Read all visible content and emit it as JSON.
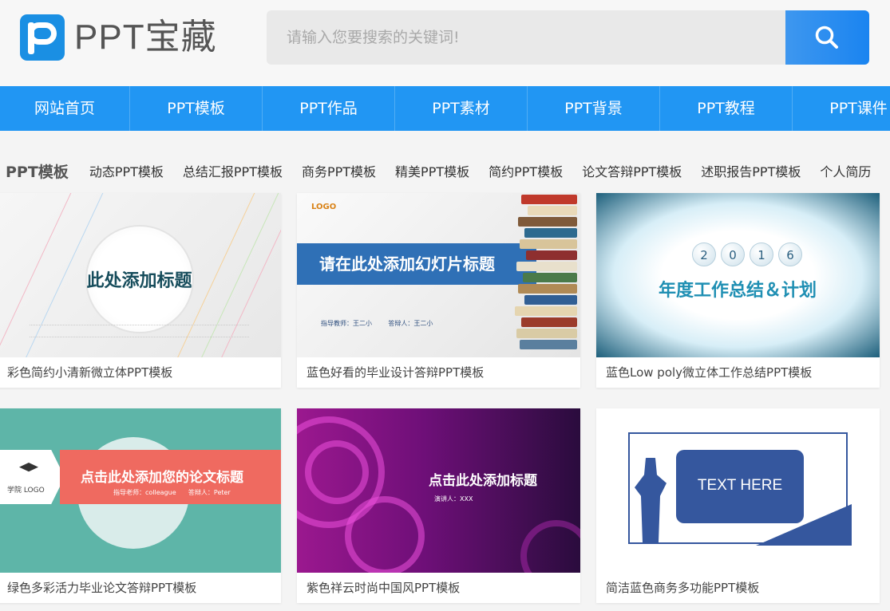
{
  "brand": {
    "logo_letter": "p",
    "name": "PPT宝藏"
  },
  "search": {
    "placeholder": "请输入您要搜索的关键词!",
    "icon": "search-icon"
  },
  "nav": {
    "items": [
      "网站首页",
      "PPT模板",
      "PPT作品",
      "PPT素材",
      "PPT背景",
      "PPT教程",
      "PPT课件"
    ]
  },
  "category": {
    "title": "PPT模板",
    "links": [
      "动态PPT模板",
      "总结汇报PPT模板",
      "商务PPT模板",
      "精美PPT模板",
      "简约PPT模板",
      "论文答辩PPT模板",
      "述职报告PPT模板",
      "个人简历"
    ]
  },
  "cards": [
    {
      "caption": "彩色简约小清新微立体PPT模板",
      "thumb": {
        "title": "此处添加标题"
      }
    },
    {
      "caption": "蓝色好看的毕业设计答辩PPT模板",
      "thumb": {
        "logo": "LOGO",
        "title": "请在此处添加幻灯片标题",
        "meta1": "指导教师：王二小",
        "meta2": "答辩人：王二小"
      }
    },
    {
      "caption": "蓝色Low poly微立体工作总结PPT模板",
      "thumb": {
        "year": [
          "2",
          "0",
          "1",
          "6"
        ],
        "title": "年度工作总结＆计划"
      }
    },
    {
      "caption": "绿色多彩活力毕业论文答辩PPT模板",
      "thumb": {
        "school": "学院 LOGO",
        "title": "点击此处添加您的论文标题",
        "meta1": "指导老师：colleague",
        "meta2": "答辩人：Peter"
      }
    },
    {
      "caption": "紫色祥云时尚中国风PPT模板",
      "thumb": {
        "title": "点击此处添加标题",
        "sub": "演讲人：XXX"
      }
    },
    {
      "caption": "简洁蓝色商务多功能PPT模板",
      "thumb": {
        "title": "TEXT HERE"
      }
    }
  ],
  "colors": {
    "accent": "#2196f3",
    "brand": "#1a8fe3"
  }
}
